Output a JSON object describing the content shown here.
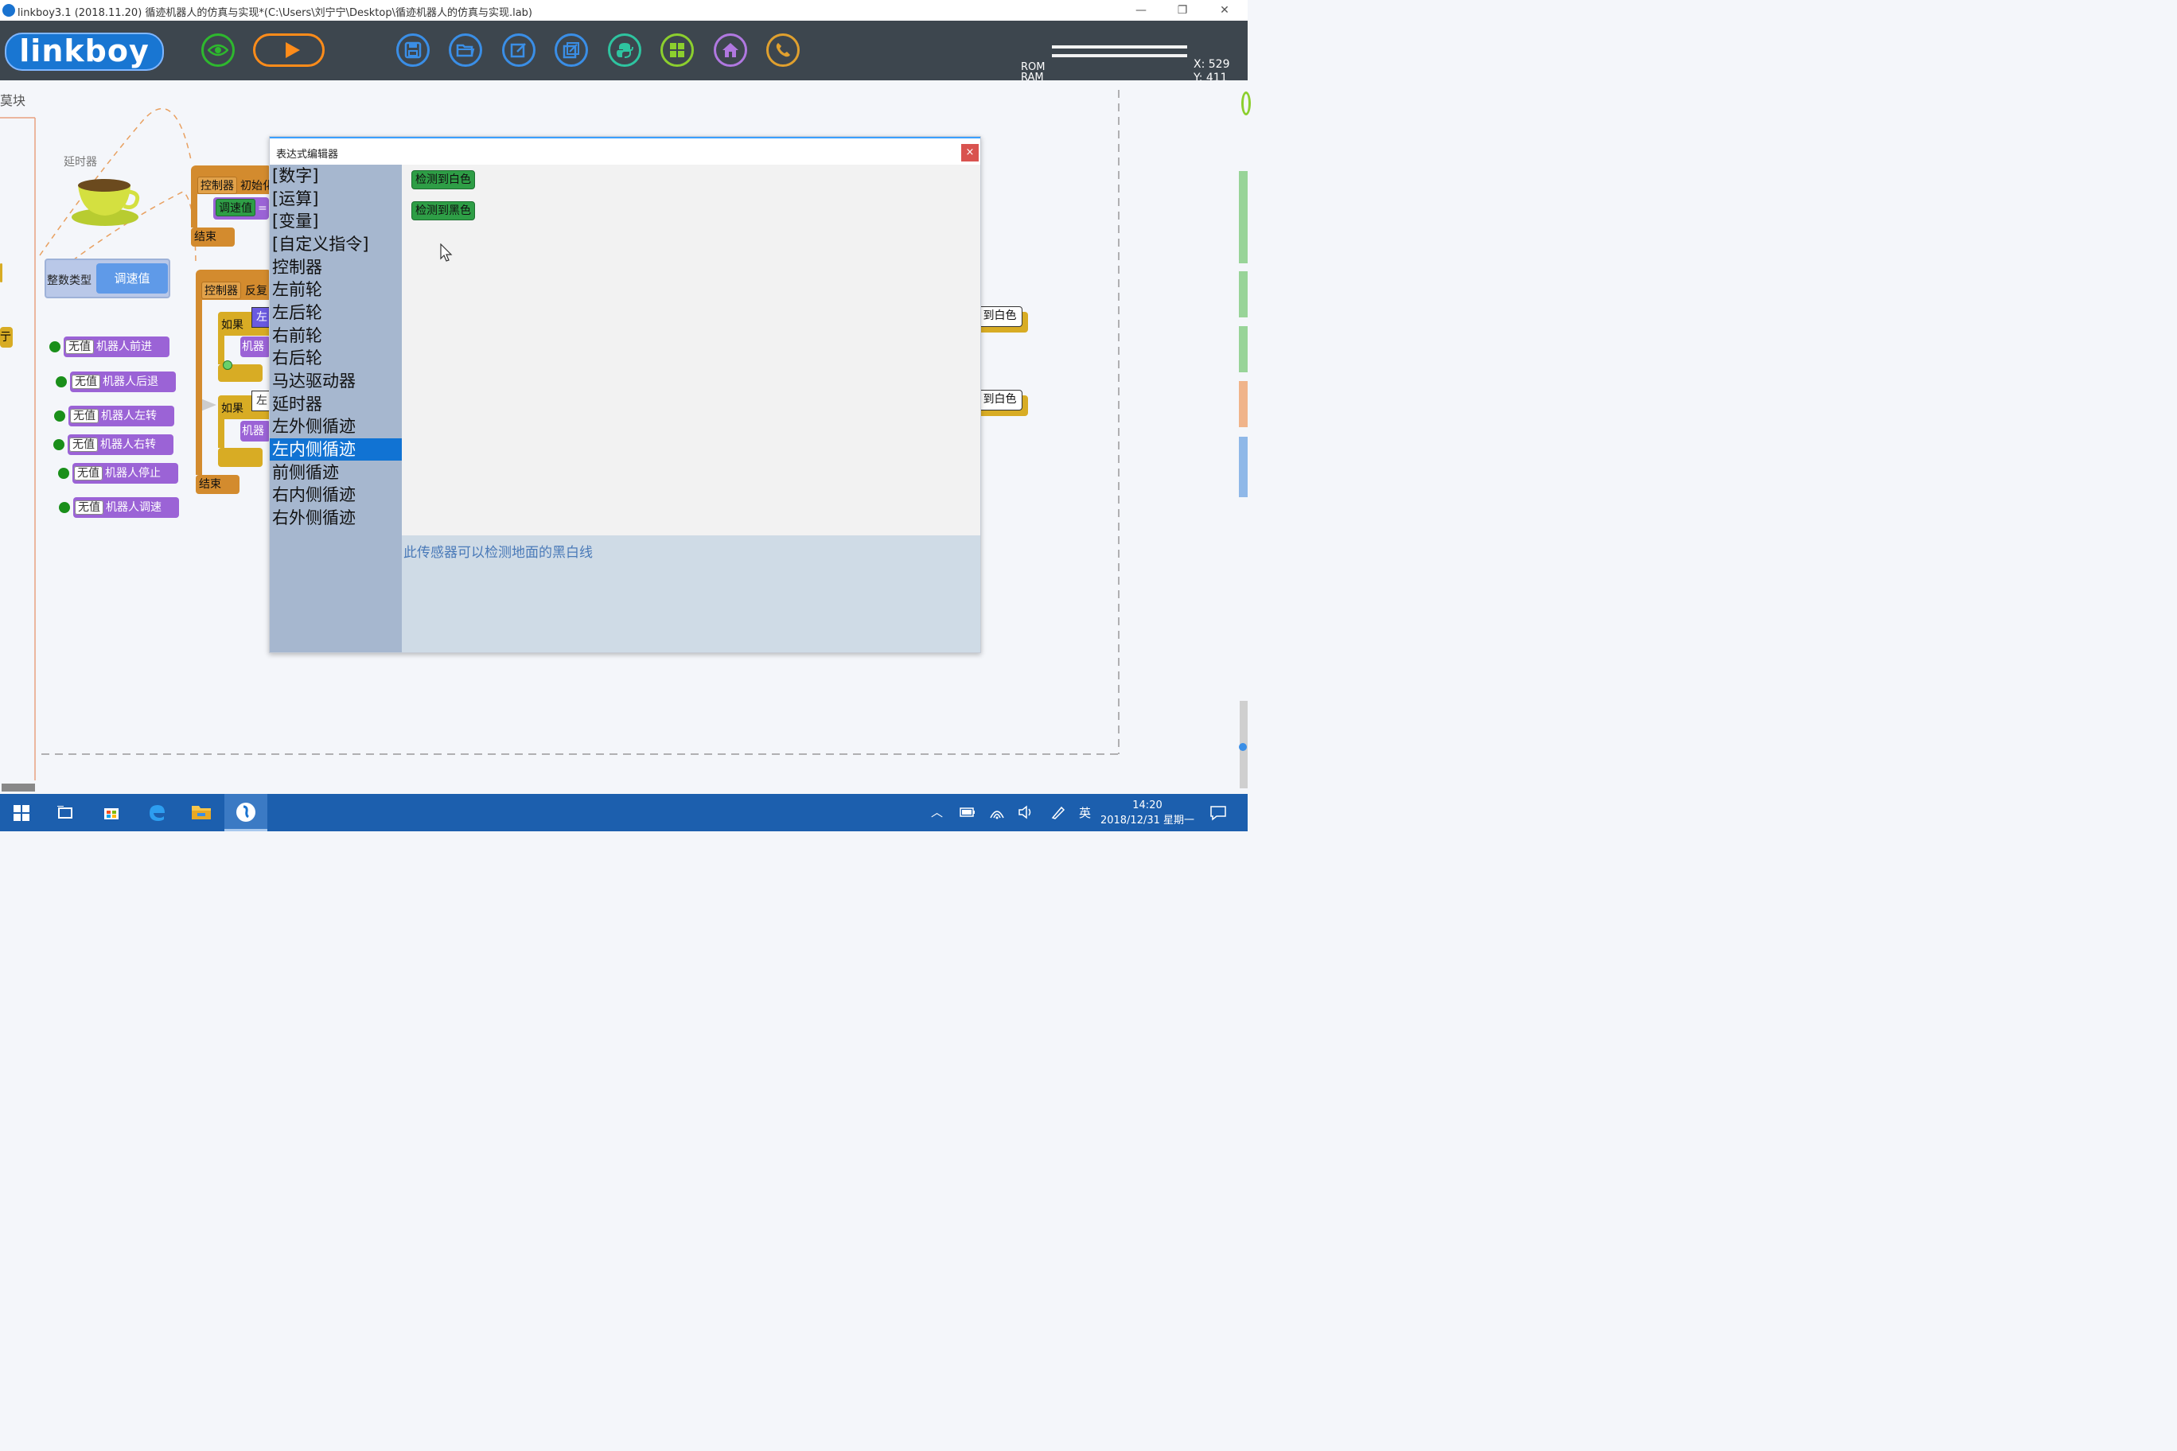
{
  "window": {
    "title": "linkboy3.1 (2018.11.20) 循迹机器人的仿真与实现*(C:\\Users\\刘宁宁\\Desktop\\循迹机器人的仿真与实现.lab)",
    "min": "—",
    "restore": "❐",
    "close": "✕"
  },
  "toolbar": {
    "logo": "linkboy",
    "rom_label": "ROM",
    "ram_label": "RAM",
    "x_readout": "X: 529",
    "y_readout": "Y: 411"
  },
  "canvas": {
    "left_edge_label": "莫块",
    "delay_label": "延时器",
    "int_type_label": "整数类型",
    "speed_value_label": "调速值",
    "left_yellow_1": "",
    "left_yellow_2": "亍",
    "controller_1": "控制器",
    "init_label": "初始化",
    "speed_val_block": "调速值",
    "eq": "=",
    "end_1": "结束",
    "controller_2": "控制器",
    "repeat_label": "反复",
    "if_1": "如果",
    "left_tag_1": "左",
    "robot_1": "机器",
    "if_2": "如果",
    "left_tag_2": "左",
    "robot_2": "机器",
    "end_2": "结束",
    "right_chip_1": "到白色",
    "right_chip_2": "到白色",
    "actions": [
      {
        "tag": "无值",
        "label": "机器人前进"
      },
      {
        "tag": "无值",
        "label": "机器人后退"
      },
      {
        "tag": "无值",
        "label": "机器人左转"
      },
      {
        "tag": "无值",
        "label": "机器人右转"
      },
      {
        "tag": "无值",
        "label": "机器人停止"
      },
      {
        "tag": "无值",
        "label": "机器人调速"
      }
    ]
  },
  "dialog": {
    "title": "表达式编辑器",
    "close": "×",
    "list": [
      "[数字]",
      "[运算]",
      "[变量]",
      "[自定义指令]",
      "控制器",
      "左前轮",
      "左后轮",
      "右前轮",
      "右后轮",
      "马达驱动器",
      "延时器",
      "左外侧循迹",
      "左内侧循迹",
      "前侧循迹",
      "右内侧循迹",
      "右外侧循迹"
    ],
    "selected_index": 12,
    "blocks": [
      "检测到白色",
      "检测到黑色"
    ],
    "description": "此传感器可以检测地面的黑白线"
  },
  "taskbar": {
    "time": "14:20",
    "date": "2018/12/31 星期一",
    "ime": "英"
  },
  "colors": {
    "toolbar_bg": "#3d464e",
    "taskbar_bg": "#1c5fae",
    "selection": "#1173d3",
    "block_green": "#2e9e46"
  }
}
